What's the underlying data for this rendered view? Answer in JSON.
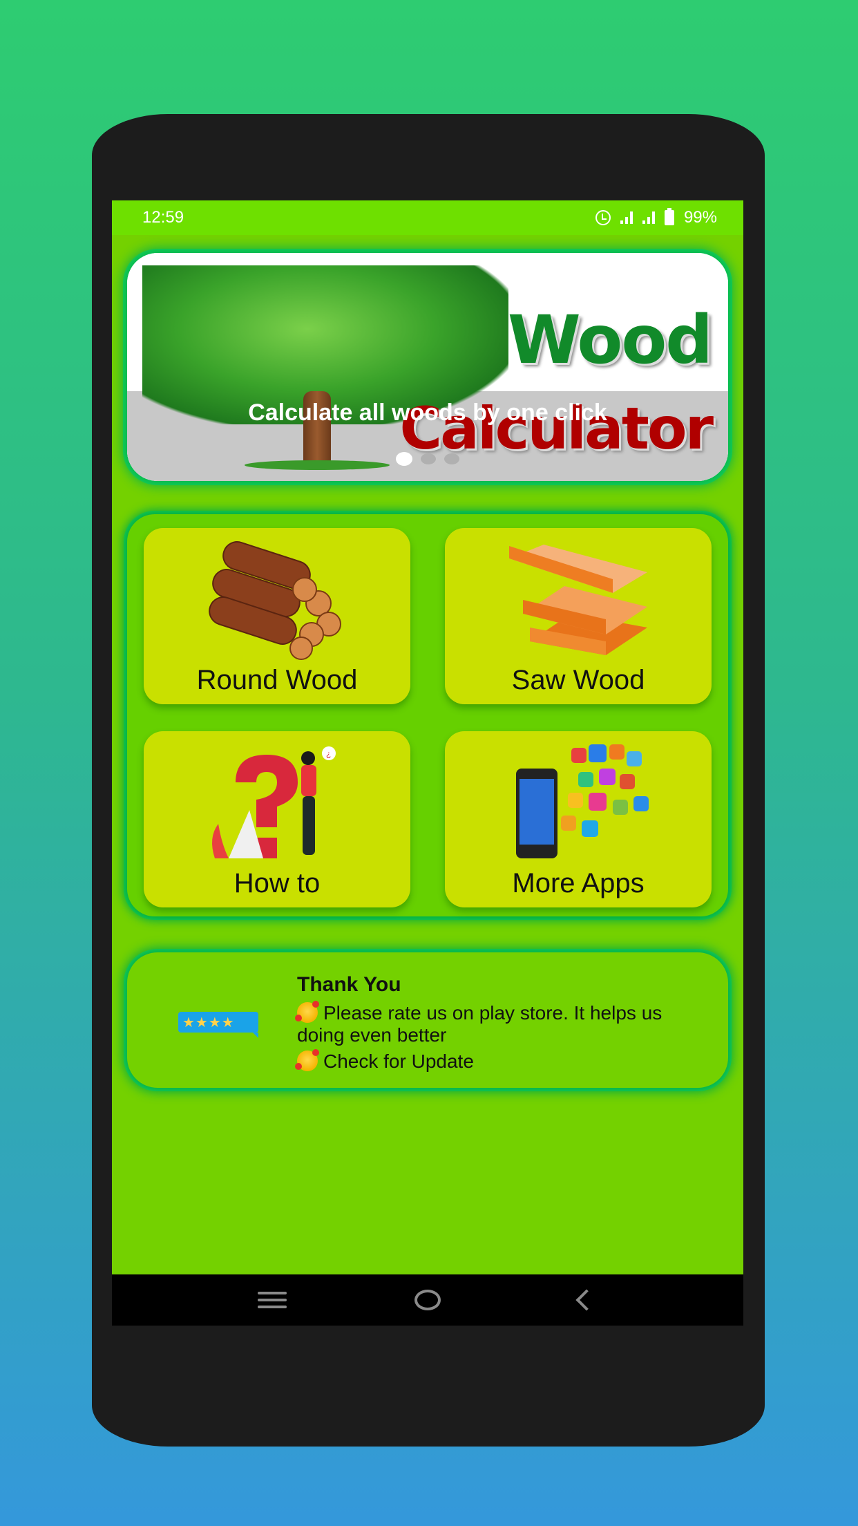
{
  "status_bar": {
    "time": "12:59",
    "icons": [
      "alarm-icon",
      "signal-icon",
      "signal-icon",
      "battery-icon"
    ],
    "battery_percent": "99%"
  },
  "banner": {
    "logo_line1": "Wood",
    "logo_line2": "Calculator",
    "caption": "Calculate all woods by one click",
    "slide_count": 3,
    "active_slide": 1
  },
  "menu": {
    "tiles": [
      {
        "label": "Round Wood",
        "icon": "logs-icon"
      },
      {
        "label": "Saw Wood",
        "icon": "planks-icon"
      },
      {
        "label": "How to",
        "icon": "question-person-icon"
      },
      {
        "label": "More Apps",
        "icon": "phone-apps-icon"
      }
    ]
  },
  "rate_card": {
    "title": "Thank You",
    "rate_text": "Please rate us on play store. It helps us doing even better",
    "update_text": "Check for Update",
    "stars": "★★★★"
  },
  "nav_bar": {
    "buttons": [
      "recent-apps",
      "home",
      "back"
    ]
  },
  "colors": {
    "screen_bg": "#74d100",
    "status_bar": "#6ee000",
    "tile_bg": "#c9e000",
    "glow": "#22dd55"
  }
}
